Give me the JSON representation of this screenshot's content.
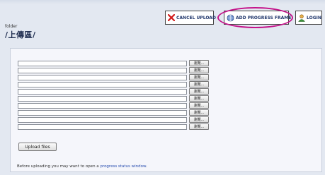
{
  "toolbar": {
    "cancel_label": "CANCEL UPLOAD",
    "add_progress_label": "ADD PROGRESS FRAME",
    "login_label": "LOGIN",
    "highlight_color": "#c4148a"
  },
  "folder": {
    "label": "folder",
    "path": "/上傳區/"
  },
  "upload": {
    "browse_label": "瀏覽...",
    "slot_count": 10,
    "upload_button_label": "Upload files"
  },
  "note": {
    "text_before": "Before uploading you may want to open a ",
    "link_text": "progress status window",
    "text_after": "."
  },
  "icons": {
    "cancel": "red-x-icon",
    "progress": "globe-progress-icon",
    "login": "user-icon"
  }
}
